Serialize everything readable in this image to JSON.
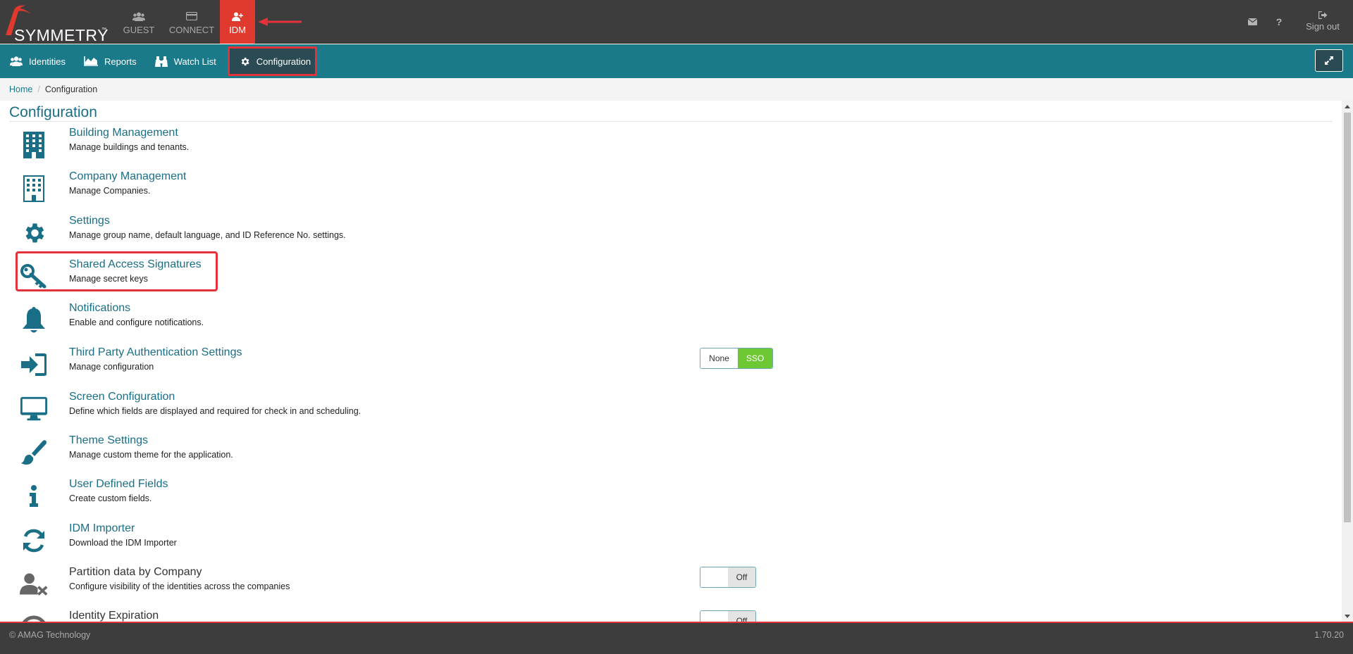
{
  "header": {
    "logo_text": "SYMMETRY",
    "logo_tm": "™",
    "nav": [
      {
        "label": "GUEST",
        "icon": "users-icon"
      },
      {
        "label": "CONNECT",
        "icon": "card-icon"
      },
      {
        "label": "IDM",
        "icon": "user-plus-icon",
        "active": true
      }
    ],
    "signout_label": "Sign out",
    "mail_icon": "envelope-icon",
    "help_label": "?"
  },
  "subnav": {
    "items": [
      {
        "label": "Identities",
        "icon": "users-icon"
      },
      {
        "label": "Reports",
        "icon": "area-chart-icon"
      },
      {
        "label": "Watch List",
        "icon": "binoculars-icon"
      },
      {
        "label": "Configuration",
        "icon": "gear-icon",
        "active": true
      }
    ]
  },
  "breadcrumb": {
    "home": "Home",
    "separator": "/",
    "current": "Configuration"
  },
  "main": {
    "title": "Configuration",
    "rows": [
      {
        "title": "Building Management",
        "desc": "Manage buildings and tenants.",
        "icon": "building-icon"
      },
      {
        "title": "Company Management",
        "desc": "Manage Companies.",
        "icon": "building-outline-icon"
      },
      {
        "title": "Settings",
        "desc": "Manage group name, default language, and ID Reference No. settings.",
        "icon": "gear-icon"
      },
      {
        "title": "Shared Access Signatures",
        "desc": "Manage secret keys",
        "icon": "key-icon"
      },
      {
        "title": "Notifications",
        "desc": "Enable and configure notifications.",
        "icon": "bell-icon"
      },
      {
        "title": "Third Party Authentication Settings",
        "desc": "Manage configuration",
        "icon": "sign-in-icon"
      },
      {
        "title": "Screen Configuration",
        "desc": "Define which fields are displayed and required for check in and scheduling.",
        "icon": "monitor-icon"
      },
      {
        "title": "Theme Settings",
        "desc": "Manage custom theme for the application.",
        "icon": "paintbrush-icon"
      },
      {
        "title": "User Defined Fields",
        "desc": "Create custom fields.",
        "icon": "info-icon"
      },
      {
        "title": "IDM Importer",
        "desc": "Download the IDM Importer",
        "icon": "refresh-icon"
      },
      {
        "title": "Partition data by Company",
        "desc": "Configure visibility of the identities across the companies",
        "icon": "user-times-icon"
      },
      {
        "title": "Identity Expiration",
        "desc": "",
        "icon": "clock-icon"
      }
    ],
    "auth_toggle": {
      "none_label": "None",
      "sso_label": "SSO",
      "selected": "SSO"
    },
    "partition_switch": {
      "state_label": "Off"
    },
    "expiration_switch": {
      "state_label": "Off"
    }
  },
  "footer": {
    "copyright": "© AMAG Technology",
    "version": "1.70.20"
  },
  "colors": {
    "header_bg": "#3d3d3d",
    "subnav_bg": "#1a7a8a",
    "active_red": "#e03a2f",
    "link_teal": "#1a6f86",
    "sso_green": "#6ec833"
  }
}
